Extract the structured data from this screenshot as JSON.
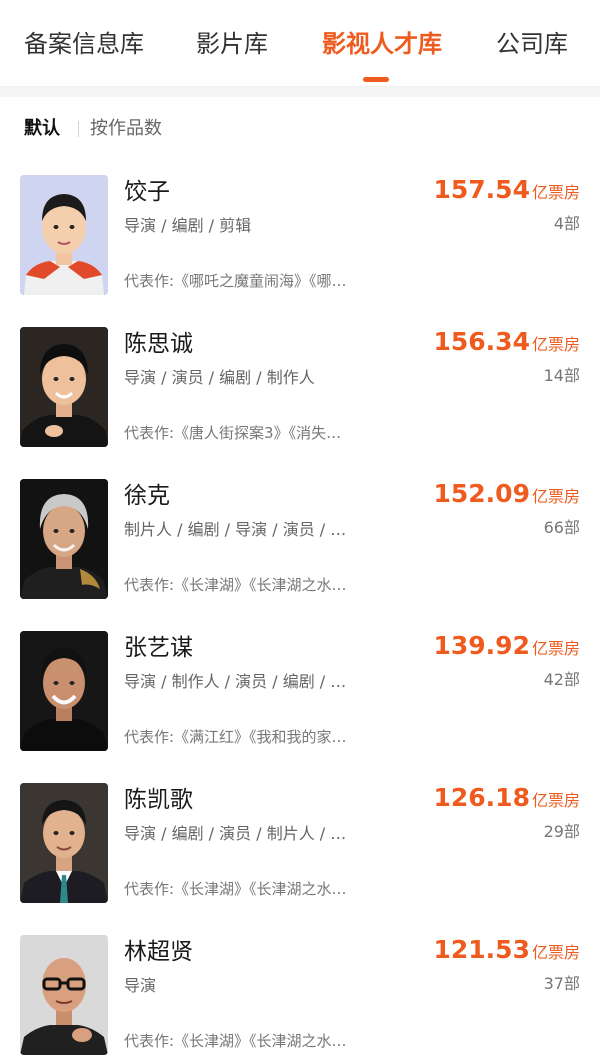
{
  "tabs": [
    {
      "label": "备案信息库",
      "active": false
    },
    {
      "label": "影片库",
      "active": false
    },
    {
      "label": "影视人才库",
      "active": true
    },
    {
      "label": "公司库",
      "active": false
    }
  ],
  "sort": {
    "options": [
      "默认",
      "按作品数"
    ],
    "active_index": 0
  },
  "colors": {
    "accent": "#ef5b1e"
  },
  "people": [
    {
      "name": "饺子",
      "roles": "导演 / 编剧 / 剪辑",
      "works": "代表作:《哪吒之魔童闹海》《哪…",
      "box_office": "157.54",
      "box_unit": "亿票房",
      "count": "4部"
    },
    {
      "name": "陈思诚",
      "roles": "导演 / 演员 / 编剧 / 制作人",
      "works": "代表作:《唐人街探案3》《消失…",
      "box_office": "156.34",
      "box_unit": "亿票房",
      "count": "14部"
    },
    {
      "name": "徐克",
      "roles": "制片人 / 编剧 / 导演 / 演员 / …",
      "works": "代表作:《长津湖》《长津湖之水…",
      "box_office": "152.09",
      "box_unit": "亿票房",
      "count": "66部"
    },
    {
      "name": "张艺谋",
      "roles": "导演 / 制作人 / 演员 / 编剧 / …",
      "works": "代表作:《满江红》《我和我的家…",
      "box_office": "139.92",
      "box_unit": "亿票房",
      "count": "42部"
    },
    {
      "name": "陈凯歌",
      "roles": "导演 / 编剧 / 演员 / 制片人 / …",
      "works": "代表作:《长津湖》《长津湖之水…",
      "box_office": "126.18",
      "box_unit": "亿票房",
      "count": "29部"
    },
    {
      "name": "林超贤",
      "roles": "导演",
      "works": "代表作:《长津湖》《长津湖之水…",
      "box_office": "121.53",
      "box_unit": "亿票房",
      "count": "37部"
    }
  ]
}
